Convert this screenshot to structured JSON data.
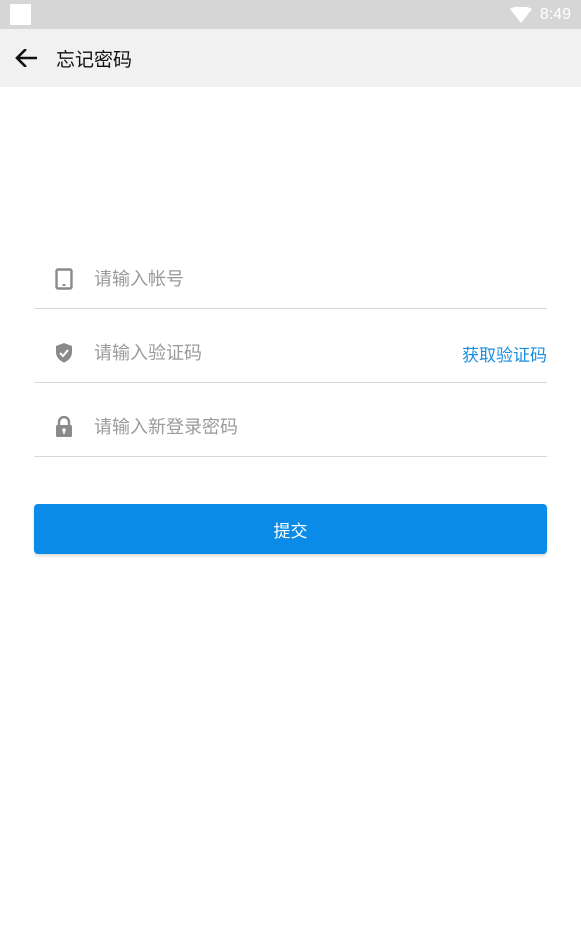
{
  "status_bar": {
    "time": "8:49"
  },
  "app_bar": {
    "title": "忘记密码"
  },
  "form": {
    "account": {
      "placeholder": "请输入帐号",
      "icon": "phone-icon"
    },
    "code": {
      "placeholder": "请输入验证码",
      "icon": "shield-check-icon",
      "get_code_label": "获取验证码"
    },
    "password": {
      "placeholder": "请输入新登录密码",
      "icon": "lock-icon"
    }
  },
  "submit_label": "提交",
  "colors": {
    "accent": "#0a8be8",
    "link": "#1a8ee0",
    "icon_gray": "#8a8a8a"
  }
}
